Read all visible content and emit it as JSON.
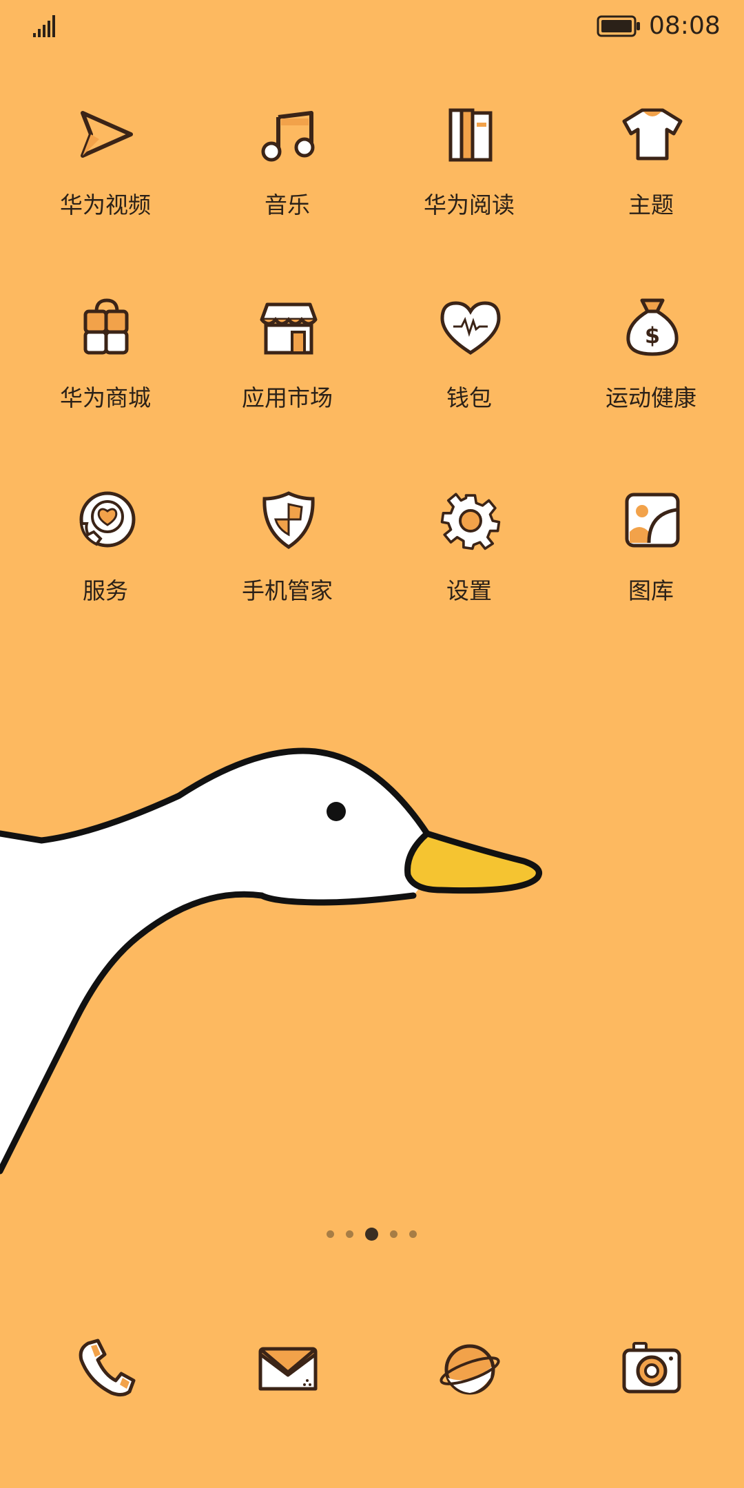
{
  "status_bar": {
    "time": "08:08",
    "signal_icon": "signal-bars-icon",
    "battery_icon": "battery-full-icon"
  },
  "apps": [
    {
      "label": "华为视频",
      "icon": "video-play-icon"
    },
    {
      "label": "音乐",
      "icon": "music-note-icon"
    },
    {
      "label": "华为阅读",
      "icon": "books-icon"
    },
    {
      "label": "主题",
      "icon": "tshirt-icon"
    },
    {
      "label": "华为商城",
      "icon": "shopping-bag-icon"
    },
    {
      "label": "应用市场",
      "icon": "storefront-icon"
    },
    {
      "label": "钱包",
      "icon": "heart-pulse-icon"
    },
    {
      "label": "运动健康",
      "icon": "money-bag-icon"
    },
    {
      "label": "服务",
      "icon": "service-phone-heart-icon"
    },
    {
      "label": "手机管家",
      "icon": "shield-icon"
    },
    {
      "label": "设置",
      "icon": "gear-icon"
    },
    {
      "label": "图库",
      "icon": "gallery-icon"
    }
  ],
  "page_indicator": {
    "total": 5,
    "active": 3
  },
  "dock": [
    {
      "icon": "phone-icon"
    },
    {
      "icon": "mail-icon"
    },
    {
      "icon": "browser-planet-icon"
    },
    {
      "icon": "camera-icon"
    }
  ],
  "colors": {
    "background": "#FDB960",
    "accent": "#F2A24A",
    "outline": "#3b2417",
    "beak": "#F5C431"
  }
}
